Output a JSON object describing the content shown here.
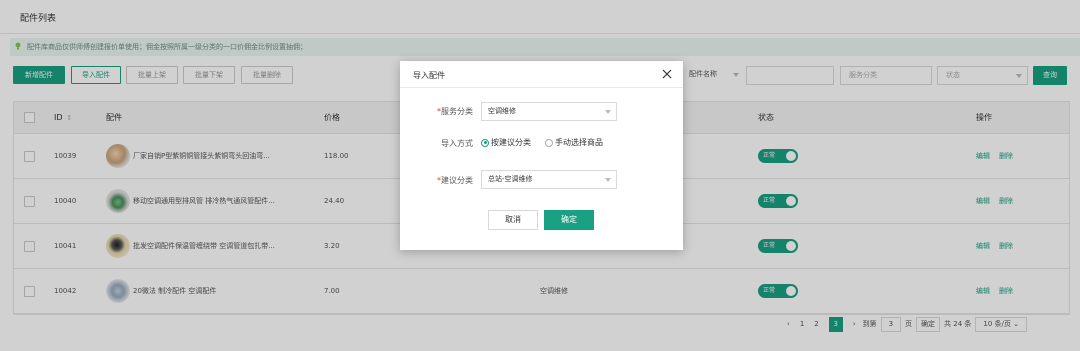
{
  "page": {
    "title": "配件列表",
    "notice": "配件库商品仅供师傅创建报价单使用；佣金按照所属一级分类的一口价佣金比例设置抽佣；"
  },
  "toolbar": {
    "add": "新增配件",
    "import": "导入配件",
    "batch_on": "批量上架",
    "batch_off": "批量下架",
    "batch_delete": "批量删除"
  },
  "filters": {
    "field_select": "配件名称",
    "keyword_placeholder": "",
    "category_placeholder": "服务分类",
    "status_placeholder": "状态",
    "search": "查询"
  },
  "table": {
    "headers": [
      "ID",
      "配件",
      "价格",
      "状态",
      "操作"
    ],
    "rows": [
      {
        "id": "10039",
        "name": "厂家自销P型紫铜铜管接头紫铜弯头回油弯...",
        "price": "118.00",
        "category": "",
        "status": "正常",
        "edit": "编辑",
        "delete": "删除"
      },
      {
        "id": "10040",
        "name": "移动空调通用型排风管 排冷热气通风管配件...",
        "price": "24.40",
        "category": "",
        "status": "正常",
        "edit": "编辑",
        "delete": "删除"
      },
      {
        "id": "10041",
        "name": "批发空调配件保温管缠绕带 空调管道包扎带...",
        "price": "3.20",
        "category": "",
        "status": "正常",
        "edit": "编辑",
        "delete": "删除"
      },
      {
        "id": "10042",
        "name": "20微法 制冷配件 空调配件",
        "price": "7.00",
        "category": "空调维修",
        "status": "正常",
        "edit": "编辑",
        "delete": "删除"
      }
    ]
  },
  "pagination": {
    "prev": "‹",
    "pages": [
      "1",
      "2",
      "3"
    ],
    "active": "3",
    "next": "›",
    "goto_label": "到第",
    "goto_value": "3",
    "page_unit": "页",
    "confirm": "确定",
    "total": "共 24 条",
    "page_size": "10 条/页"
  },
  "modal": {
    "title": "导入配件",
    "service_label": "服务分类",
    "service_value": "空调维修",
    "mode_label": "导入方式",
    "mode_option_1": "按建议分类",
    "mode_option_2": "手动选择商品",
    "suggest_label": "建议分类",
    "suggest_value": "总站-空调维修",
    "cancel": "取消",
    "confirm": "确定"
  },
  "colors": {
    "primary": "#1aa082"
  }
}
